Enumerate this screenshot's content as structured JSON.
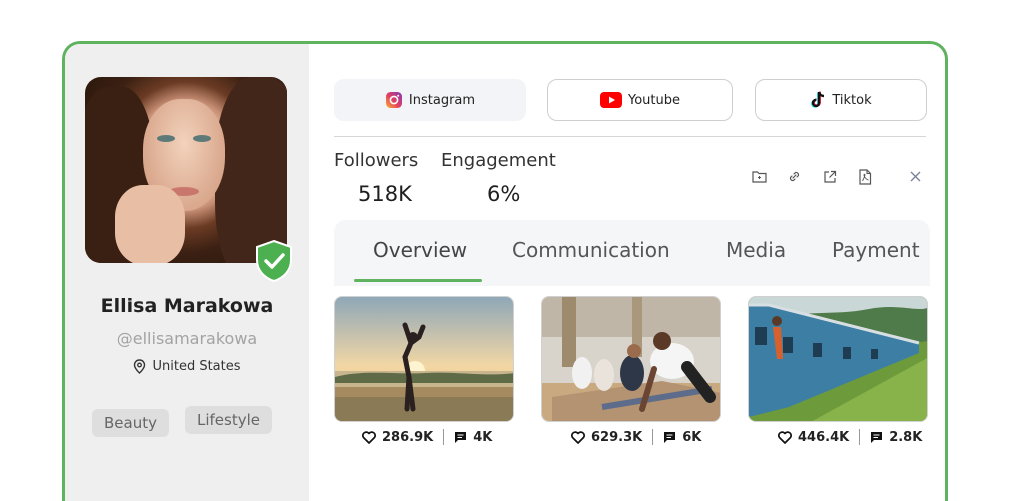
{
  "profile": {
    "name": "Ellisa Marakowa",
    "handle": "@ellisamarakowa",
    "location": "United States",
    "tags": [
      "Beauty",
      "Lifestyle"
    ]
  },
  "platforms": [
    {
      "label": "Instagram",
      "icon": "instagram-icon",
      "active": true
    },
    {
      "label": "Youtube",
      "icon": "youtube-icon",
      "active": false
    },
    {
      "label": "Tiktok",
      "icon": "tiktok-icon",
      "active": false
    }
  ],
  "stats": {
    "followers_label": "Followers",
    "followers_value": "518K",
    "engagement_label": "Engagement",
    "engagement_value": "6%"
  },
  "toolbar_icons": [
    "folder-icon",
    "link-icon",
    "external-link-icon",
    "pdf-icon",
    "close-icon"
  ],
  "tabs": [
    {
      "label": "Overview",
      "active": true
    },
    {
      "label": "Communication",
      "active": false
    },
    {
      "label": "Media",
      "active": false
    },
    {
      "label": "Payment",
      "active": false
    }
  ],
  "posts": [
    {
      "likes": "286.9K",
      "comments": "4K"
    },
    {
      "likes": "629.3K",
      "comments": "6K"
    },
    {
      "likes": "446.4K",
      "comments": "2.8K"
    }
  ],
  "colors": {
    "accent": "#5fb35f",
    "sidebar_bg": "#efefef",
    "verified": "#4caf50",
    "youtube": "#ff0000"
  }
}
